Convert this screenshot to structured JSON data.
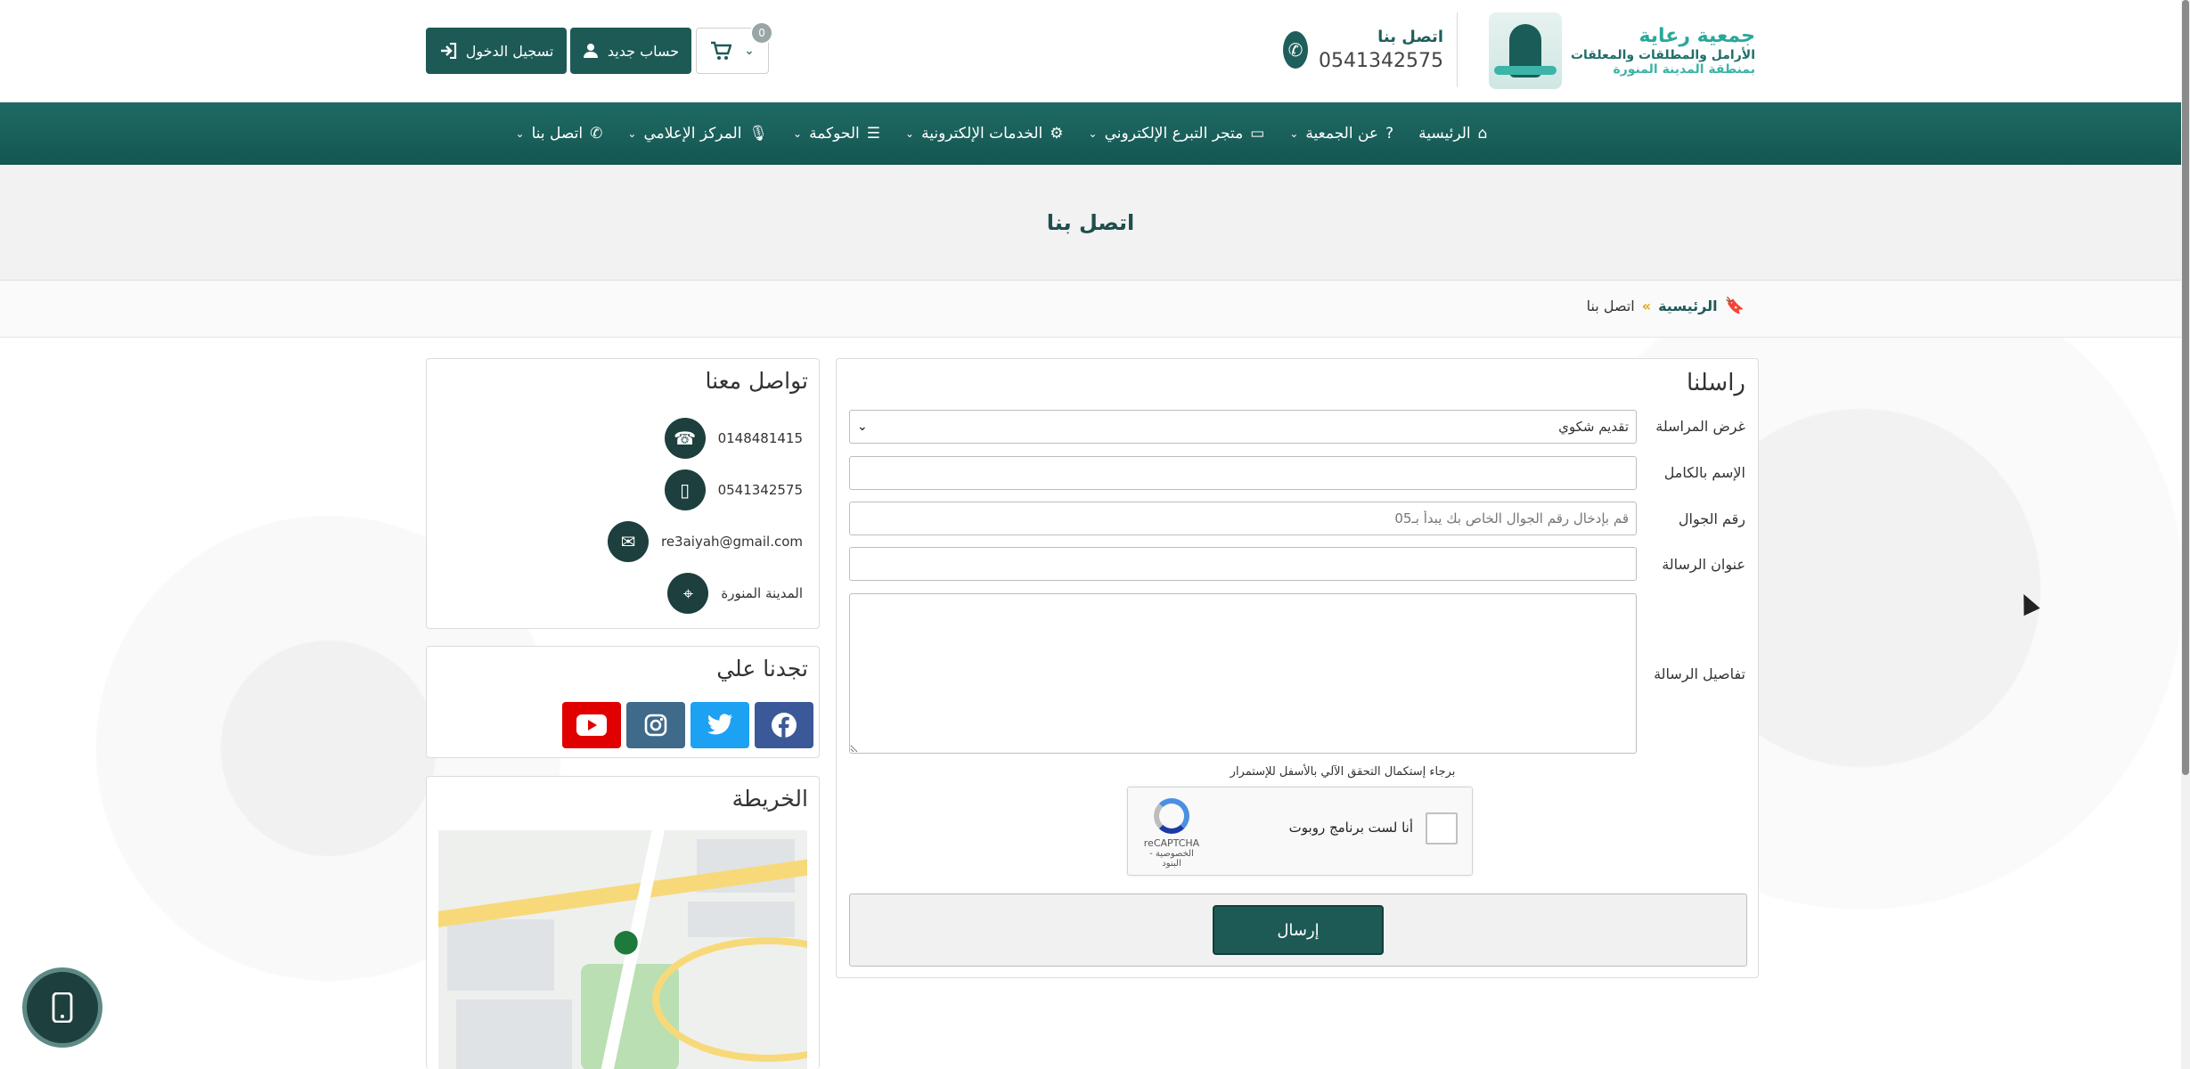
{
  "header": {
    "logo": {
      "brand": "جمعية رعاية",
      "line1": "الأرامل والمطلقات والمعلقات",
      "line2": "بمنطقة المدينة المنورة"
    },
    "contact": {
      "label": "اتصل بنا",
      "phone": "0541342575"
    },
    "login_label": "تسجيل الدخول",
    "register_label": "حساب جديد",
    "cart_count": "0"
  },
  "nav": {
    "items": [
      {
        "label": "الرئيسية",
        "icon": "home-icon",
        "caret": false
      },
      {
        "label": "عن الجمعية",
        "icon": "question-icon",
        "caret": true
      },
      {
        "label": "متجر التبرع الإلكتروني",
        "icon": "card-icon",
        "caret": true
      },
      {
        "label": "الخدمات الإلكترونية",
        "icon": "gears-icon",
        "caret": true
      },
      {
        "label": "الحوكمة",
        "icon": "list-icon",
        "caret": true
      },
      {
        "label": "المركز الإعلامي",
        "icon": "microphone-icon",
        "caret": true
      },
      {
        "label": "اتصل بنا",
        "icon": "phone-icon",
        "caret": true
      }
    ]
  },
  "page": {
    "title": "اتصل بنا"
  },
  "breadcrumb": {
    "home": "الرئيسية",
    "separator": "»",
    "current": "اتصل بنا"
  },
  "form": {
    "title": "راسلنا",
    "purpose_label": "غرض المراسلة",
    "purpose_value": "تقديم شكوي",
    "fullname_label": "الإسم بالكامل",
    "fullname_value": "",
    "mobile_label": "رقم الجوال",
    "mobile_placeholder": "قم بإدخال رقم الجوال الخاص بك يبدأ بـ05",
    "subject_label": "عنوان الرسالة",
    "subject_value": "",
    "details_label": "تفاصيل الرسالة",
    "captcha_note": "برجاء إستكمال التحقق الآلي بالأسفل للإستمرار",
    "recaptcha": {
      "label": "أنا لست برنامج روبوت",
      "brand": "reCAPTCHA",
      "terms": "الخصوصية - البنود"
    },
    "submit_label": "إرسال"
  },
  "sidebar": {
    "contact_title": "تواصل معنا",
    "contacts": [
      {
        "icon": "telephone-icon",
        "value": "0148481415"
      },
      {
        "icon": "mobile-icon",
        "value": "0541342575"
      },
      {
        "icon": "envelope-icon",
        "value": "re3aiyah@gmail.com"
      },
      {
        "icon": "location-icon",
        "value": "المدينة المنورة"
      }
    ],
    "social_title": "تجدنا علي",
    "social": [
      {
        "name": "facebook",
        "icon": "facebook-icon",
        "color": "#3b5998"
      },
      {
        "name": "twitter",
        "icon": "twitter-icon",
        "color": "#1da1f2"
      },
      {
        "name": "instagram",
        "icon": "instagram-icon",
        "color": "#3f6a8a"
      },
      {
        "name": "youtube",
        "icon": "youtube-icon",
        "color": "#e00000"
      }
    ],
    "map_title": "الخريطة"
  },
  "colors": {
    "primary": "#1d5a56",
    "nav": "#1a615b",
    "accent": "#e0a800"
  }
}
